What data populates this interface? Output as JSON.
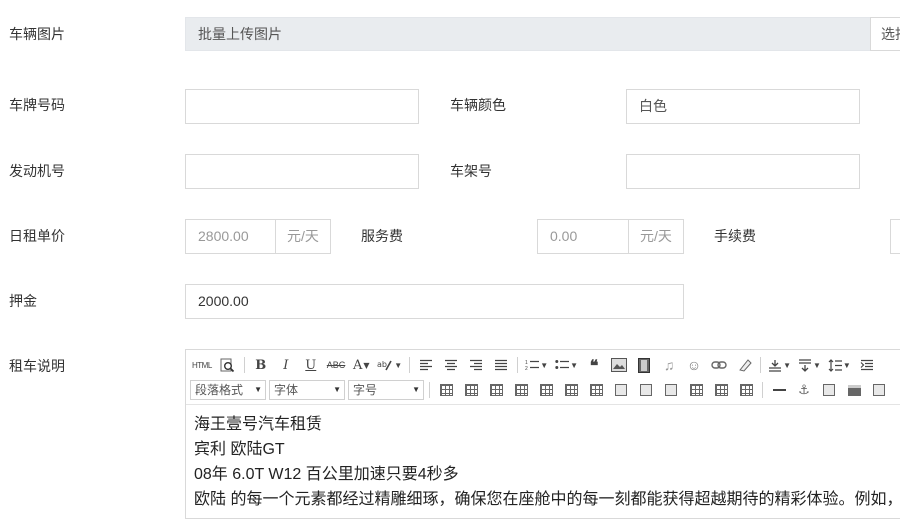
{
  "form": {
    "vehicle_images": {
      "label": "车辆图片",
      "upload_text": "批量上传图片",
      "select_button": "选择"
    },
    "plate_number": {
      "label": "车牌号码",
      "value": ""
    },
    "vehicle_color": {
      "label": "车辆颜色",
      "value": "白色"
    },
    "engine_number": {
      "label": "发动机号",
      "value": ""
    },
    "frame_number": {
      "label": "车架号",
      "value": ""
    },
    "daily_rent": {
      "label": "日租单价",
      "value": "2800.00",
      "unit": "元/天"
    },
    "service_fee": {
      "label": "服务费",
      "value": "0.00",
      "unit": "元/天"
    },
    "handling_fee": {
      "label": "手续费"
    },
    "deposit": {
      "label": "押金",
      "value": "2000.00"
    },
    "rental_description": {
      "label": "租车说明"
    }
  },
  "editor": {
    "toolbar": {
      "html": "HTML",
      "bold": "B",
      "italic": "I",
      "underline": "U",
      "strikethrough": "ABC",
      "font_color": "A",
      "paragraph_format": "段落格式",
      "font_family": "字体",
      "font_size": "字号"
    },
    "content": [
      "海王壹号汽车租赁",
      "宾利 欧陆GT",
      "08年 6.0T W12 百公里加速只要4秒多",
      "欧陆 的每一个元素都经过精雕细琢，确保您在座舱中的每一刻都能获得超越期待的精彩体验。例如，"
    ]
  },
  "colors": {
    "border": "#d9d9d9",
    "upload_bg": "#e9ecef",
    "text": "#333333",
    "muted": "#999999"
  }
}
